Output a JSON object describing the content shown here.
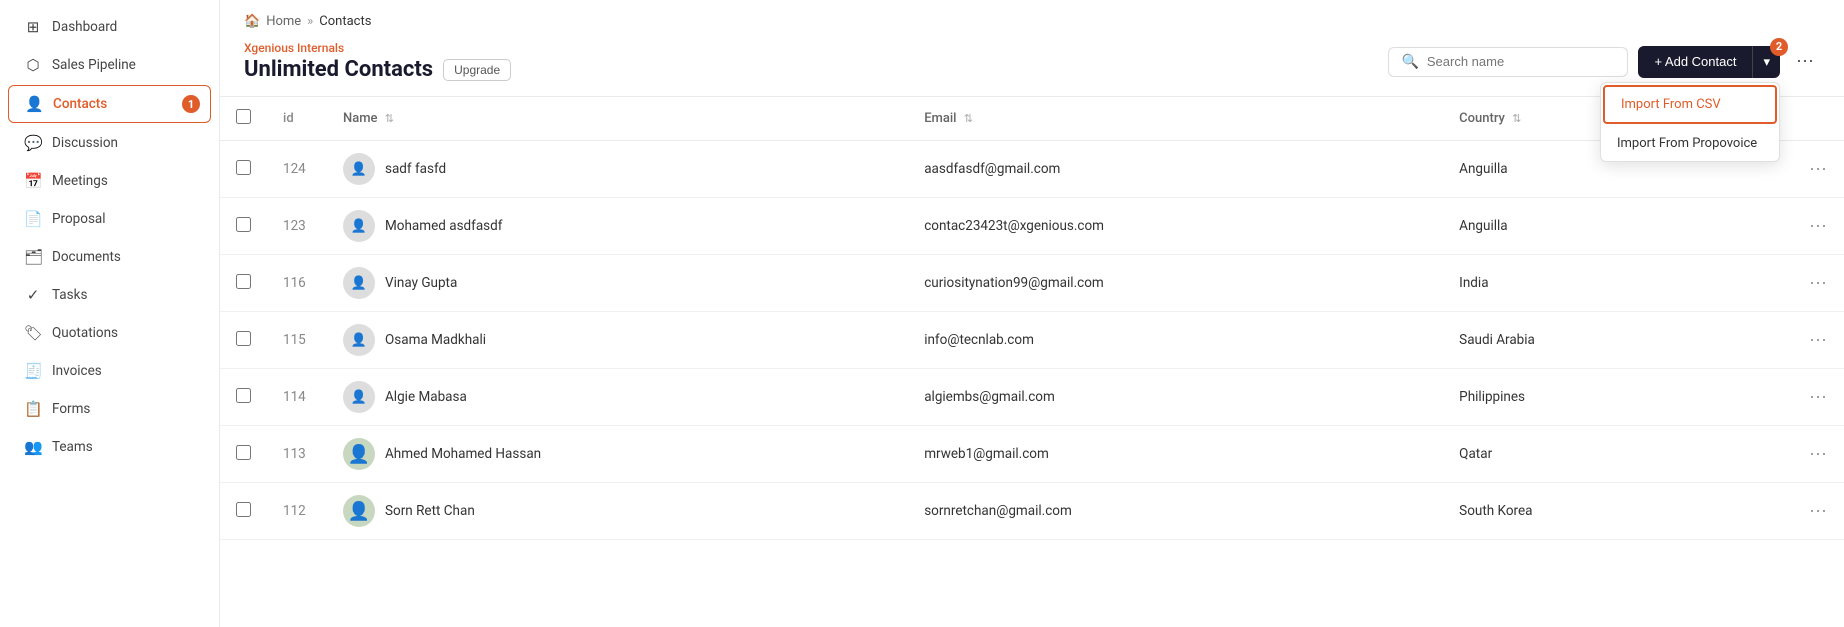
{
  "sidebar": {
    "items": [
      {
        "label": "Dashboard",
        "icon": "⊞",
        "id": "dashboard",
        "active": false,
        "badge": null
      },
      {
        "label": "Sales Pipeline",
        "icon": "⬡",
        "id": "sales-pipeline",
        "active": false,
        "badge": null
      },
      {
        "label": "Contacts",
        "icon": "👤",
        "id": "contacts",
        "active": true,
        "badge": "1"
      },
      {
        "label": "Discussion",
        "icon": "💬",
        "id": "discussion",
        "active": false,
        "badge": null
      },
      {
        "label": "Meetings",
        "icon": "📅",
        "id": "meetings",
        "active": false,
        "badge": null
      },
      {
        "label": "Proposal",
        "icon": "📄",
        "id": "proposal",
        "active": false,
        "badge": null
      },
      {
        "label": "Documents",
        "icon": "🗂",
        "id": "documents",
        "active": false,
        "badge": null
      },
      {
        "label": "Tasks",
        "icon": "✓",
        "id": "tasks",
        "active": false,
        "badge": null
      },
      {
        "label": "Quotations",
        "icon": "🏷",
        "id": "quotations",
        "active": false,
        "badge": null
      },
      {
        "label": "Invoices",
        "icon": "🧾",
        "id": "invoices",
        "active": false,
        "badge": null
      },
      {
        "label": "Forms",
        "icon": "📋",
        "id": "forms",
        "active": false,
        "badge": null
      },
      {
        "label": "Teams",
        "icon": "👥",
        "id": "teams",
        "active": false,
        "badge": null
      }
    ]
  },
  "breadcrumb": {
    "home": "Home",
    "separator": "»",
    "current": "Contacts"
  },
  "page": {
    "org": "Xgenious Internals",
    "title": "Unlimited Contacts",
    "upgrade_label": "Upgrade"
  },
  "search": {
    "placeholder": "Search name"
  },
  "toolbar": {
    "add_contact_label": "+ Add Contact",
    "dropdown_arrow": "▾",
    "more_options": "⋯",
    "notification_badge": "2"
  },
  "dropdown_menu": {
    "items": [
      {
        "label": "Import From CSV",
        "highlighted": true
      },
      {
        "label": "Import From Propovoice",
        "highlighted": false
      }
    ]
  },
  "table": {
    "columns": [
      {
        "label": "id",
        "sortable": false
      },
      {
        "label": "Name",
        "sortable": true
      },
      {
        "label": "Email",
        "sortable": true
      },
      {
        "label": "Country",
        "sortable": true
      }
    ],
    "rows": [
      {
        "id": "124",
        "name": "sadf fasfd",
        "email": "aasdfasdf@gmail.com",
        "country": "Anguilla",
        "avatar_type": "default"
      },
      {
        "id": "123",
        "name": "Mohamed asdfasdf",
        "email": "contac23423t@xgenious.com",
        "country": "Anguilla",
        "avatar_type": "default"
      },
      {
        "id": "116",
        "name": "Vinay Gupta",
        "email": "curiositynation99@gmail.com",
        "country": "India",
        "avatar_type": "default"
      },
      {
        "id": "115",
        "name": "Osama Madkhali",
        "email": "info@tecnlab.com",
        "country": "Saudi Arabia",
        "avatar_type": "default"
      },
      {
        "id": "114",
        "name": "Algie Mabasa",
        "email": "algiembs@gmail.com",
        "country": "Philippines",
        "avatar_type": "default"
      },
      {
        "id": "113",
        "name": "Ahmed Mohamed Hassan",
        "email": "mrweb1@gmail.com",
        "country": "Qatar",
        "avatar_type": "photo"
      },
      {
        "id": "112",
        "name": "Sorn Rett Chan",
        "email": "sornretchan@gmail.com",
        "country": "South Korea",
        "avatar_type": "photo"
      }
    ]
  }
}
